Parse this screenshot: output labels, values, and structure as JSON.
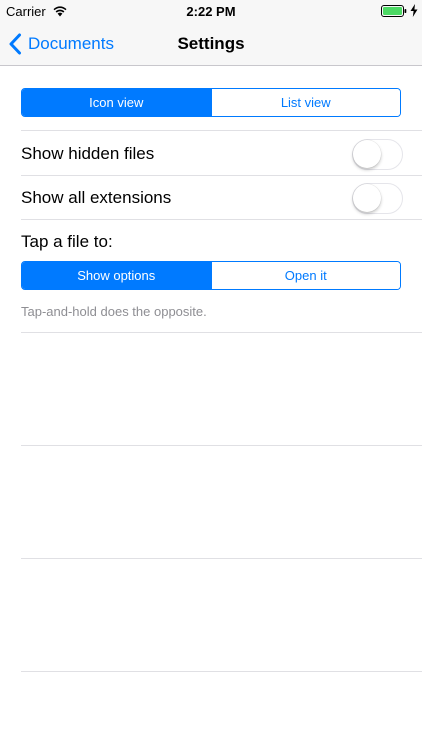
{
  "status_bar": {
    "carrier": "Carrier",
    "time": "2:22 PM",
    "icons": {
      "wifi": "wifi-icon",
      "battery": "battery-icon",
      "charging": "charging-bolt-icon"
    },
    "battery_color": "#4cd964"
  },
  "nav": {
    "back_label": "Documents",
    "title": "Settings",
    "back_icon": "chevron-left-icon"
  },
  "view_mode": {
    "options": [
      "Icon view",
      "List view"
    ],
    "selected": "Icon view"
  },
  "settings": [
    {
      "label": "Show hidden files",
      "enabled": false
    },
    {
      "label": "Show all extensions",
      "enabled": false
    }
  ],
  "tap_action": {
    "title": "Tap a file to:",
    "options": [
      "Show options",
      "Open it"
    ],
    "selected": "Show options",
    "footnote": "Tap-and-hold does the opposite."
  },
  "colors": {
    "accent": "#007aff",
    "bar_background": "#f7f7f7",
    "separator": "#e0e0e4",
    "secondary_text": "#8e8e93"
  }
}
